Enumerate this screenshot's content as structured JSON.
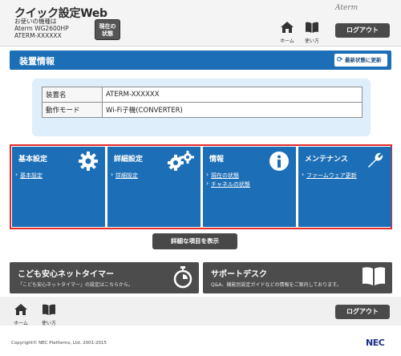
{
  "header": {
    "title": "クイック設定Web",
    "device_caption": "お使いの機種は",
    "device_model": "Aterm WG2600HP",
    "device_name": "ATERM-XXXXXX",
    "status_button_line1": "現在の",
    "status_button_line2": "状態",
    "brand": "Aterm",
    "home_label": "ホーム",
    "help_label": "使い方",
    "logout_label": "ログアウト"
  },
  "device_panel": {
    "title": "装置情報",
    "refresh_label": "最新状態に更新",
    "rows": [
      {
        "key": "装置名",
        "value": "ATERM-XXXXXX"
      },
      {
        "key": "動作モード",
        "value": "Wi-Fi子機(CONVERTER)"
      }
    ]
  },
  "tiles": [
    {
      "title": "基本設定",
      "icon": "gear-icon",
      "links": [
        "基本設定"
      ]
    },
    {
      "title": "詳細設定",
      "icon": "gears-icon",
      "links": [
        "詳細設定"
      ]
    },
    {
      "title": "情報",
      "icon": "info-icon",
      "links": [
        "現在の状態",
        "チャネルの状態"
      ]
    },
    {
      "title": "メンテナンス",
      "icon": "wrench-icon",
      "links": [
        "ファームウェア更新"
      ]
    }
  ],
  "details_button": "詳細な項目を表示",
  "banners": {
    "timer": {
      "title": "こども安心ネットタイマー",
      "subtitle": "「こども安心ネットタイマー」の設定はこちらから。",
      "icon": "stopwatch-icon"
    },
    "support": {
      "title": "サポートデスク",
      "subtitle": "Q&A、機能別設定ガイドなどの情報をご案内しております。",
      "icon": "book-icon"
    }
  },
  "footer": {
    "home_label": "ホーム",
    "help_label": "使い方",
    "logout_label": "ログアウト",
    "copyright": "Copyright© NEC Platforms, Ltd. 2001-2015",
    "logo": "NEC"
  },
  "colors": {
    "primary_blue": "#1c6fb6",
    "highlight_red": "#e22b2b",
    "dark_button": "#4a4a4a"
  }
}
